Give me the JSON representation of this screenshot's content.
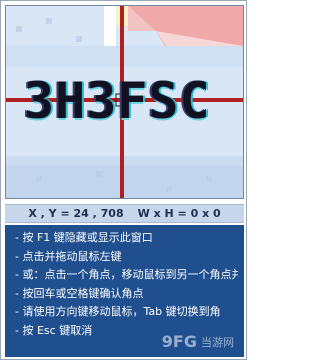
{
  "magnifier": {
    "zoomed_text": "3H3FSC",
    "crosshair_color": "#b02020",
    "accent_color": "#1f4f8f"
  },
  "readout": {
    "position": "X , Y = 24 , 708",
    "size": "W x H = 0 x 0"
  },
  "help": {
    "items": [
      "- 按 F1 键隐藏或显示此窗口",
      "- 点击并拖动鼠标左键",
      "- 或：点击一个角点，移动鼠标到另一个角点并点击",
      "- 按回车或空格键确认角点",
      "- 请使用方向键移动鼠标，Tab 键切换到角",
      "- 按 Esc 键取消"
    ]
  },
  "watermark": {
    "logo_text": "9FG",
    "site_text": "当游网"
  }
}
